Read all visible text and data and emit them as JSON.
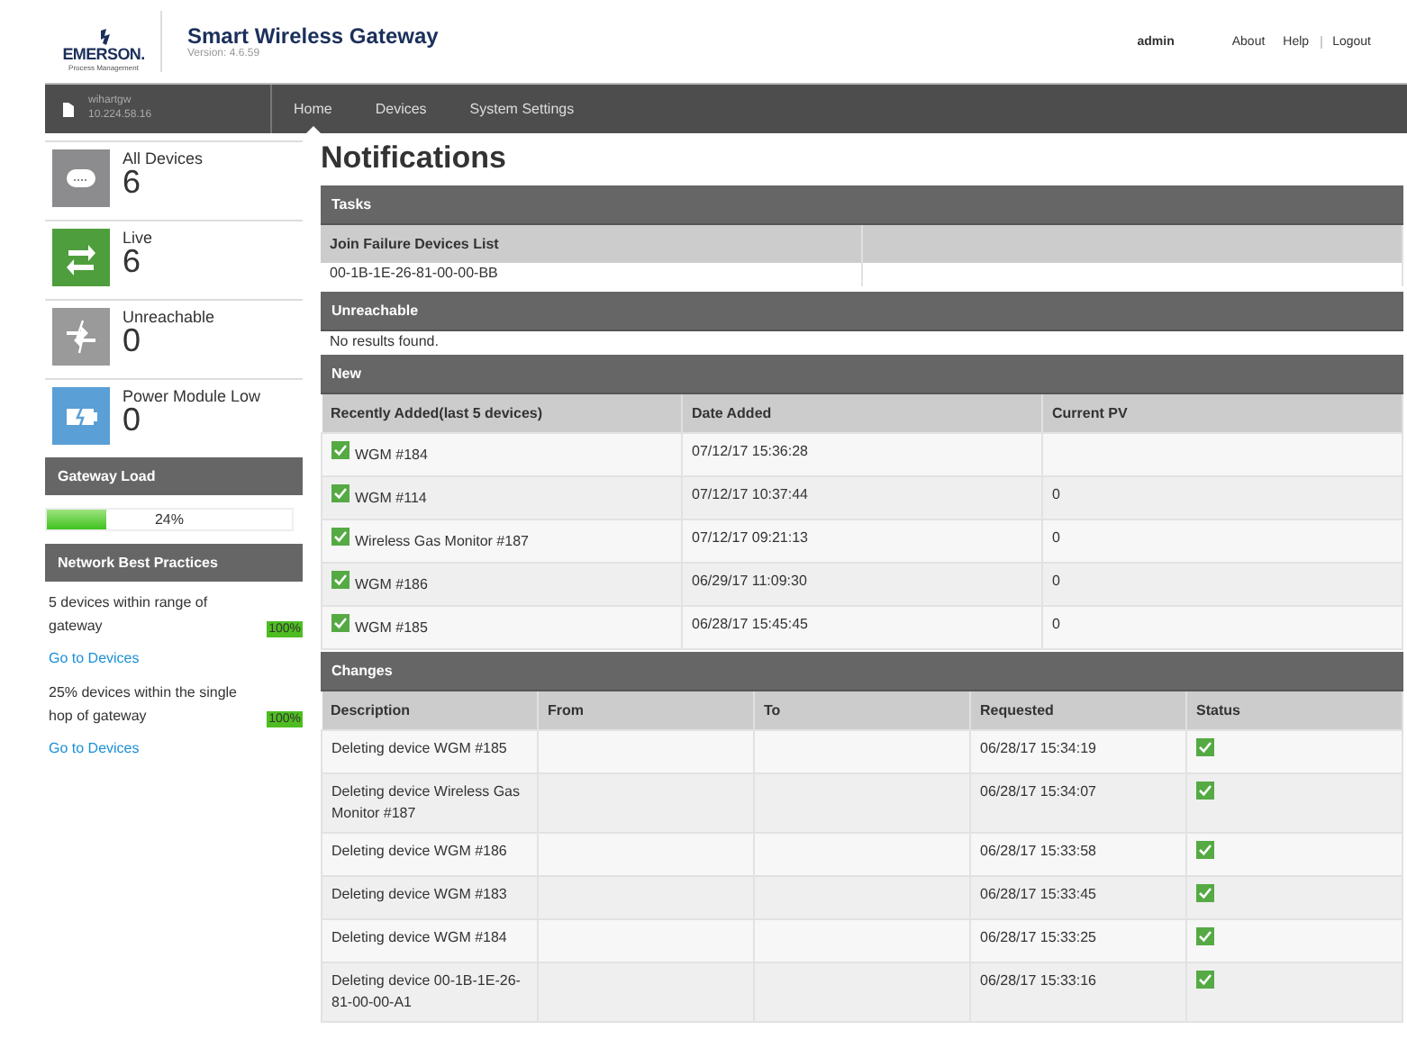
{
  "header": {
    "brand": "EMERSON.",
    "brand_sub": "Process Management",
    "title": "Smart Wireless Gateway",
    "version": "Version: 4.6.59",
    "user": "admin",
    "links": [
      "About",
      "Help",
      "Logout"
    ]
  },
  "gateway": {
    "name": "wihartgw",
    "ip": "10.224.58.16"
  },
  "nav": [
    {
      "label": "Home",
      "selected": true
    },
    {
      "label": "Devices",
      "selected": false
    },
    {
      "label": "System Settings",
      "selected": false
    }
  ],
  "stats": [
    {
      "kind": "all",
      "label": "All Devices",
      "count": "6",
      "color": "#8c8c8e"
    },
    {
      "kind": "live",
      "label": "Live",
      "count": "6",
      "color": "#4f9e3d"
    },
    {
      "kind": "unreachable",
      "label": "Unreachable",
      "count": "0",
      "color": "#9a9a9a"
    },
    {
      "kind": "power",
      "label": "Power Module Low",
      "count": "0",
      "color": "#5a9fd6"
    }
  ],
  "gateway_load": {
    "title": "Gateway Load",
    "level": 0.24,
    "reading": "24%"
  },
  "best_practices": {
    "title": "Network Best Practices",
    "items": [
      {
        "text": "5 devices within range of gateway",
        "score": "100%",
        "link": "Go to Devices"
      },
      {
        "text": "25% devices within the single hop of gateway",
        "score": "100%",
        "link": "Go to Devices"
      }
    ]
  },
  "page_title": "Notifications",
  "tasks": {
    "title": "Tasks",
    "columns": [
      "Join Failure Devices List"
    ],
    "rows": [
      "00-1B-1E-26-81-00-00-BB"
    ]
  },
  "unreachable": {
    "title": "Unreachable",
    "empty": "No results found."
  },
  "new": {
    "title": "New",
    "columns": [
      "Recently Added(last 5 devices)",
      "Date Added",
      "Current PV"
    ],
    "rows": [
      {
        "name": "WGM #184",
        "date": "07/12/17 15:36:28",
        "pv": "",
        "checked": true
      },
      {
        "name": "WGM #114",
        "date": "07/12/17 10:37:44",
        "pv": "0",
        "checked": true
      },
      {
        "name": "Wireless Gas Monitor #187",
        "date": "07/12/17 09:21:13",
        "pv": "0",
        "checked": true
      },
      {
        "name": "WGM #186",
        "date": "06/29/17 11:09:30",
        "pv": "0",
        "checked": true
      },
      {
        "name": "WGM #185",
        "date": "06/28/17 15:45:45",
        "pv": "0",
        "checked": true
      }
    ]
  },
  "changes": {
    "title": "Changes",
    "columns": [
      "Description",
      "From",
      "To",
      "Requested",
      "Status"
    ],
    "rows": [
      {
        "description": "Deleting device WGM #185",
        "requested": "06/28/17 15:34:19",
        "done": true
      },
      {
        "description": "Deleting device Wireless Gas Monitor #187",
        "requested": "06/28/17 15:34:07",
        "done": true
      },
      {
        "description": "Deleting device WGM #186",
        "requested": "06/28/17 15:33:58",
        "done": true
      },
      {
        "description": "Deleting device WGM #183",
        "requested": "06/28/17 15:33:45",
        "done": true
      },
      {
        "description": "Deleting device WGM #184",
        "requested": "06/28/17 15:33:25",
        "done": true
      },
      {
        "description": "Deleting device 00-1B-1E-26-81-00-00-A1",
        "requested": "06/28/17 15:33:16",
        "done": true
      }
    ]
  }
}
